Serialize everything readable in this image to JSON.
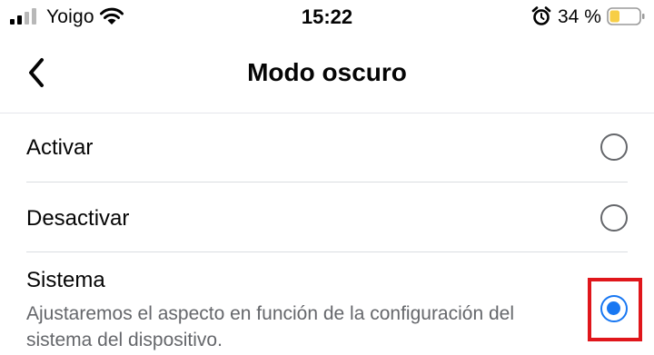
{
  "status_bar": {
    "carrier": "Yoigo",
    "time": "15:22",
    "battery_percent": "34 %",
    "battery_level": 0.34,
    "icons": [
      "signal-icon",
      "wifi-icon",
      "alarm-icon",
      "battery-icon"
    ]
  },
  "header": {
    "title": "Modo oscuro",
    "back_icon": "chevron-left-icon"
  },
  "options": [
    {
      "label": "Activar",
      "selected": false
    },
    {
      "label": "Desactivar",
      "selected": false
    },
    {
      "label": "Sistema",
      "description": "Ajustaremos el aspecto en función de la configuración del sistema del dispositivo.",
      "selected": true
    }
  ],
  "colors": {
    "accent": "#1877f2",
    "highlight": "#e0161b",
    "secondary_text": "#65676b",
    "battery_low": "#f7ce46"
  }
}
